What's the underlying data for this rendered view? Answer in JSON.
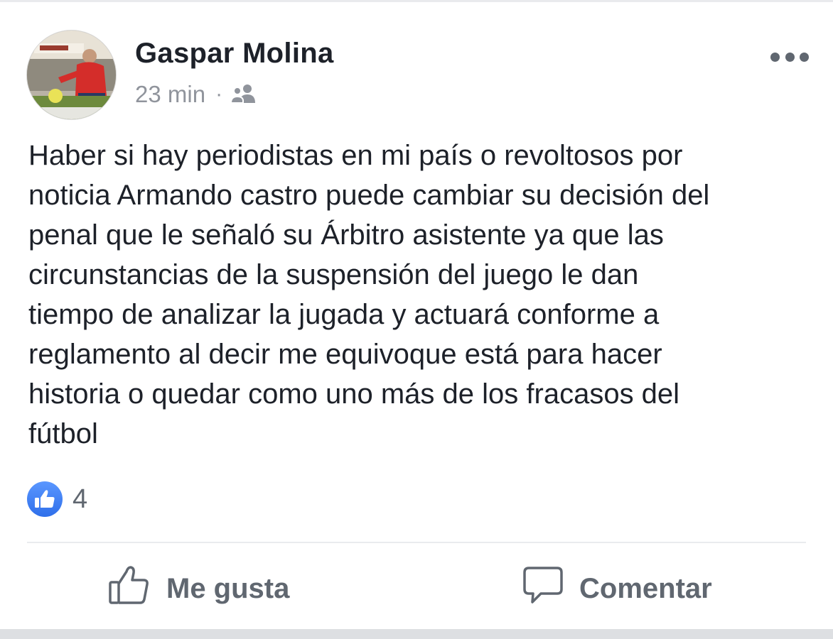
{
  "post": {
    "author_name": "Gaspar Molina",
    "timestamp": "23 min",
    "separator": "·",
    "audience_icon": "friends-icon",
    "body_text": "Haber si hay periodistas en mi país o revoltosos por\nnoticia Armando castro puede cambiar su decisión del\npenal que le señaló su Árbitro asistente ya que las\ncircunstancias de la suspensión del juego le dan\ntiempo de analizar la jugada y actuará conforme a\nreglamento al decir me equivoque está para hacer\nhistoria o quedar como uno más de los fracasos del\nfútbol",
    "reactions": {
      "icon": "thumbs-up-icon",
      "count": "4"
    }
  },
  "actions": {
    "like_label": "Me gusta",
    "comment_label": "Comentar"
  },
  "colors": {
    "like_blue": "#3b82f6",
    "text": "#1d2129",
    "secondary_text": "#90949c",
    "action_text": "#606770"
  }
}
